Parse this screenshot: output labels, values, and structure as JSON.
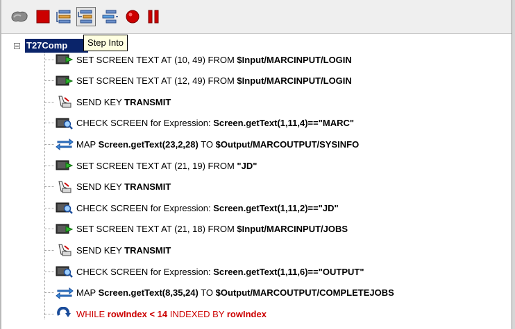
{
  "tooltip": "Step Into",
  "tree": {
    "root_label": "T27Comp",
    "nodes": [
      {
        "icon": "set-screen-text-icon",
        "parts": [
          {
            "t": "SET SCREEN TEXT AT (10, 49) FROM "
          },
          {
            "t": "$Input/MARCINPUT/LOGIN",
            "b": true
          }
        ]
      },
      {
        "icon": "set-screen-text-icon",
        "parts": [
          {
            "t": "SET SCREEN TEXT AT (12, 49) FROM "
          },
          {
            "t": "$Input/MARCINPUT/LOGIN",
            "b": true
          }
        ]
      },
      {
        "icon": "send-key-icon",
        "parts": [
          {
            "t": "SEND KEY "
          },
          {
            "t": "TRANSMIT",
            "b": true
          }
        ]
      },
      {
        "icon": "check-screen-icon",
        "parts": [
          {
            "t": "CHECK SCREEN for Expression: "
          },
          {
            "t": "Screen.getText(1,11,4)==\"MARC\"",
            "b": true
          }
        ]
      },
      {
        "icon": "map-icon",
        "parts": [
          {
            "t": "MAP "
          },
          {
            "t": "Screen.getText(23,2,28)",
            "b": true
          },
          {
            "t": " TO "
          },
          {
            "t": "$Output/MARCOUTPUT/SYSINFO",
            "b": true
          }
        ]
      },
      {
        "icon": "set-screen-text-icon",
        "parts": [
          {
            "t": "SET SCREEN TEXT AT (21, 19) FROM "
          },
          {
            "t": "\"JD\"",
            "b": true
          }
        ]
      },
      {
        "icon": "send-key-icon",
        "parts": [
          {
            "t": "SEND KEY "
          },
          {
            "t": "TRANSMIT",
            "b": true
          }
        ]
      },
      {
        "icon": "check-screen-icon",
        "parts": [
          {
            "t": "CHECK SCREEN for Expression: "
          },
          {
            "t": "Screen.getText(1,11,2)==\"JD\"",
            "b": true
          }
        ]
      },
      {
        "icon": "set-screen-text-icon",
        "parts": [
          {
            "t": "SET SCREEN TEXT AT (21, 18) FROM "
          },
          {
            "t": "$Input/MARCINPUT/JOBS",
            "b": true
          }
        ]
      },
      {
        "icon": "send-key-icon",
        "parts": [
          {
            "t": "SEND KEY "
          },
          {
            "t": "TRANSMIT",
            "b": true
          }
        ]
      },
      {
        "icon": "check-screen-icon",
        "parts": [
          {
            "t": "CHECK SCREEN for Expression: "
          },
          {
            "t": "Screen.getText(1,11,6)==\"OUTPUT\"",
            "b": true
          }
        ]
      },
      {
        "icon": "map-icon",
        "parts": [
          {
            "t": "MAP "
          },
          {
            "t": "Screen.getText(8,35,24)",
            "b": true
          },
          {
            "t": " TO "
          },
          {
            "t": "$Output/MARCOUTPUT/COMPLETEJOBS",
            "b": true
          }
        ]
      },
      {
        "icon": "while-loop-icon",
        "red": true,
        "parts": [
          {
            "t": "WHILE "
          },
          {
            "t": "rowIndex < 14",
            "b": true
          },
          {
            "t": " INDEXED BY "
          },
          {
            "t": "rowIndex",
            "b": true
          }
        ]
      }
    ]
  },
  "toolbar": {
    "buttons": [
      {
        "icon": "run-icon",
        "selected": false
      },
      {
        "icon": "stop-icon",
        "selected": false
      },
      {
        "icon": "step-over-icon",
        "selected": false
      },
      {
        "icon": "step-into-icon",
        "selected": true
      },
      {
        "icon": "step-out-icon",
        "selected": false
      },
      {
        "icon": "breakpoint-icon",
        "selected": false
      },
      {
        "icon": "pause-icon",
        "selected": false
      }
    ]
  },
  "colors": {
    "selection_bg": "#0a246a",
    "tooltip_bg": "#ffffe1",
    "stop_red": "#cc0000",
    "loop_text_red": "#cc0000"
  }
}
